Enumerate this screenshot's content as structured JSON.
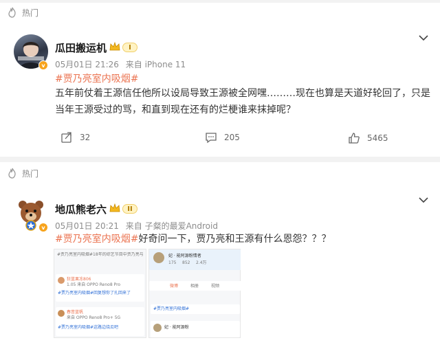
{
  "posts": [
    {
      "hot_label": "热门",
      "username": "瓜田搬运机",
      "level": "I",
      "time": "05月01日 21:26",
      "source": "来自 iPhone 11",
      "topic": "#贾乃亮室内吸烟#",
      "text": "五年前仗着王源信任他所以设局导致王源被全网嘿………现在也算是天道好轮回了，只是当年王源受过的骂，和直到现在还有的烂梗谁来抹掉呢？",
      "actions": {
        "repost": "32",
        "comment": "205",
        "like": "5465"
      }
    },
    {
      "hot_label": "热门",
      "username": "地瓜熊老六",
      "level": "II",
      "time": "05月01日 20:21",
      "source": "来自 子粲的最爱Android",
      "topic": "#贾乃亮室内吸烟#",
      "text": "好奇问一下，贾乃亮和王源有什么恩怨？？？",
      "thumbs": {
        "left": {
          "header": "#贾乃亮室内吸烟#18年的综艺节目中贾乃亮与王源的合作..",
          "user1": "狂蓝果冻806",
          "user1_meta": "1.05 来自 OPPO Reno8 Pro",
          "user1_text": "#贾乃亮室内吸烟#回复想你了扎回来了",
          "user2": "春昔蓝帆",
          "user2_meta": "来自 OPPO Reno8 Pro+ 5G",
          "user2_text": "#贾乃亮室内吸烟#这路边烧瓜吧"
        },
        "right": {
          "name": "妃 · 能阿源粉情者",
          "stats": [
            "175",
            "852",
            "2.4万"
          ],
          "tab_active": "微博",
          "tab2": "相册",
          "tab3": "视频",
          "pin_text": "#贾乃亮室内吸烟#",
          "name2": "妃 · 能阿源粉"
        }
      }
    }
  ]
}
